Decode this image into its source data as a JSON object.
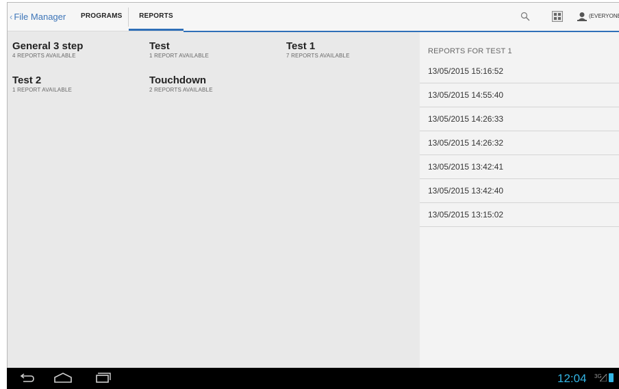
{
  "actionbar": {
    "back_label": "File Manager",
    "tabs": [
      {
        "label": "PROGRAMS",
        "selected": false
      },
      {
        "label": "REPORTS",
        "selected": true
      }
    ],
    "user_label": "(EVERYONE",
    "icons": [
      "search-icon",
      "grid-view-icon",
      "user-icon"
    ],
    "accent_color": "#2f6fb8"
  },
  "programs": [
    {
      "name": "General 3 step",
      "count": "4 REPORTS AVAILABLE"
    },
    {
      "name": "Test",
      "count": "1 REPORT AVAILABLE"
    },
    {
      "name": "Test 1",
      "count": "7 REPORTS AVAILABLE"
    },
    {
      "name": "Test 2",
      "count": "1 REPORT AVAILABLE"
    },
    {
      "name": "Touchdown",
      "count": "2 REPORTS AVAILABLE"
    }
  ],
  "reports_panel": {
    "title": "REPORTS FOR TEST 1",
    "reports": [
      "13/05/2015 15:16:52",
      "13/05/2015 14:55:40",
      "13/05/2015 14:26:33",
      "13/05/2015 14:26:32",
      "13/05/2015 13:42:41",
      "13/05/2015 13:42:40",
      "13/05/2015 13:15:02"
    ]
  },
  "navbar": {
    "icons": [
      "back-icon",
      "home-icon",
      "recent-apps-icon"
    ],
    "clock": "12:04",
    "network": "3G",
    "clock_color": "#33b5e5"
  }
}
